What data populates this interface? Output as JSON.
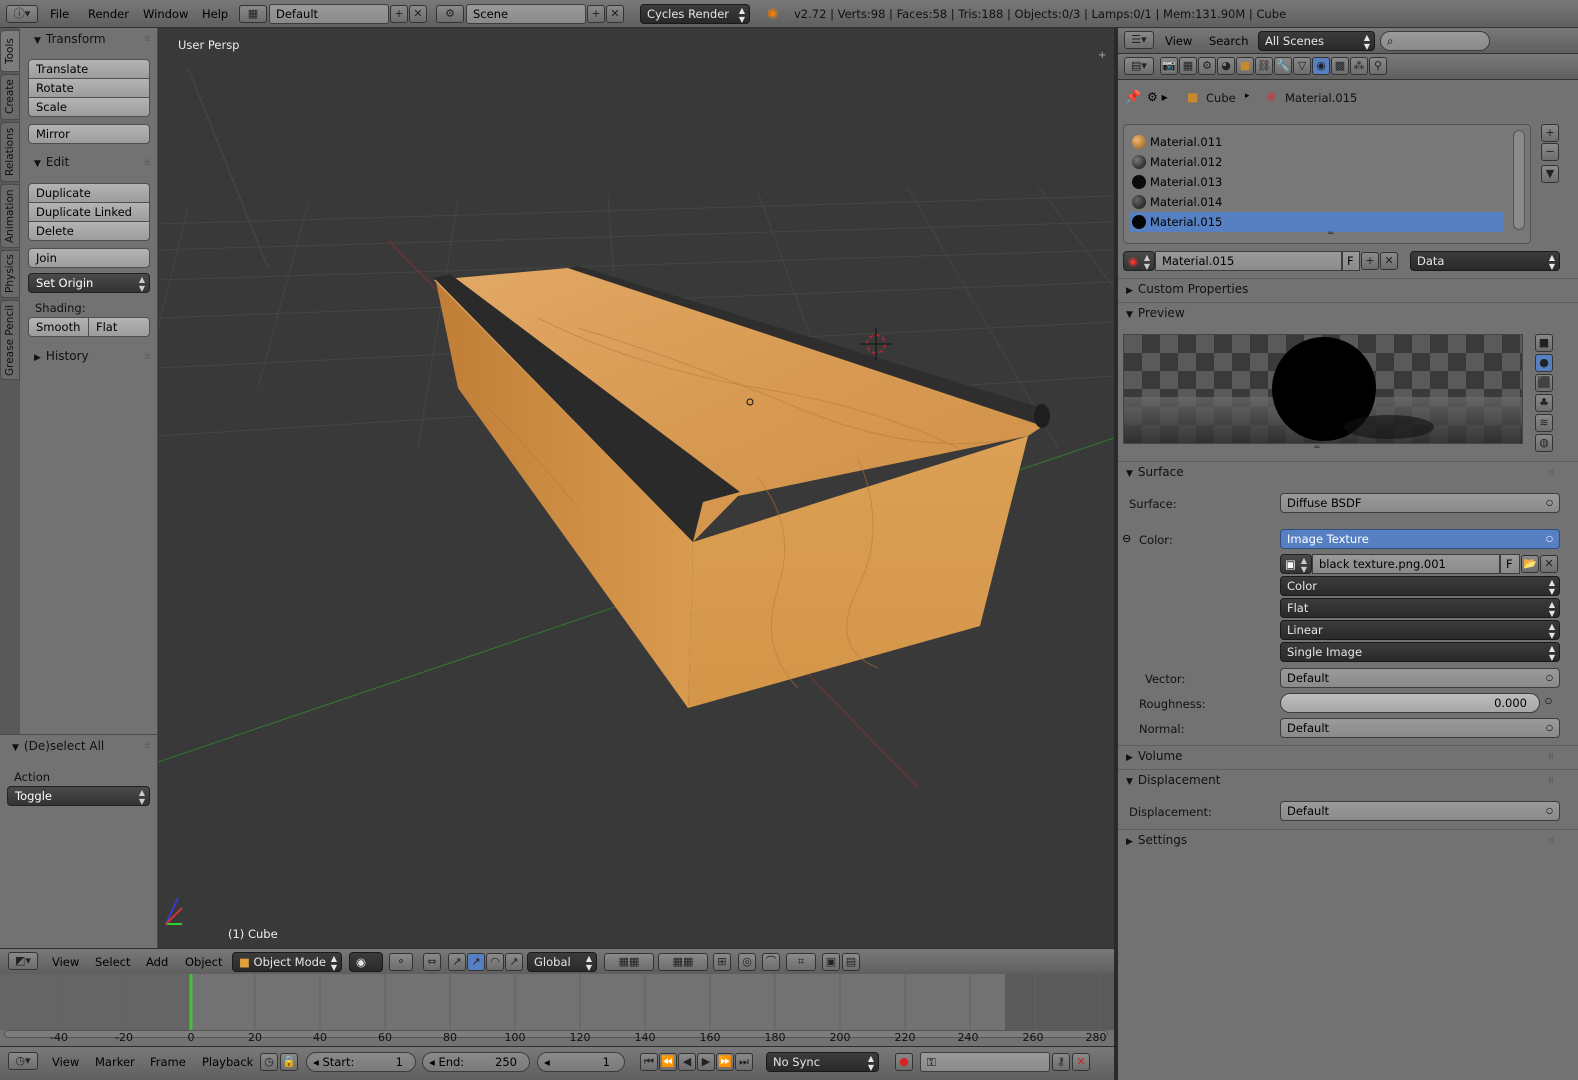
{
  "topbar": {
    "menus": [
      "File",
      "Render",
      "Window",
      "Help"
    ],
    "layout": "Default",
    "scene": "Scene",
    "engine": "Cycles Render",
    "stats": "v2.72 | Verts:98 | Faces:58 | Tris:188 | Objects:0/3 | Lamps:0/1 | Mem:131.90M | Cube"
  },
  "tool_tabs": [
    "Tools",
    "Create",
    "Relations",
    "Animation",
    "Physics",
    "Grease Pencil"
  ],
  "toolshelf": {
    "transform_title": "Transform",
    "translate": "Translate",
    "rotate": "Rotate",
    "scale": "Scale",
    "mirror": "Mirror",
    "edit_title": "Edit",
    "duplicate": "Duplicate",
    "duplicate_linked": "Duplicate Linked",
    "delete": "Delete",
    "join": "Join",
    "set_origin": "Set Origin",
    "shading_label": "Shading:",
    "smooth": "Smooth",
    "flat": "Flat",
    "history_title": "History"
  },
  "operator": {
    "title": "(De)select All",
    "action_label": "Action",
    "action_value": "Toggle"
  },
  "viewport": {
    "view_name": "User Persp",
    "object_label": "(1) Cube"
  },
  "view3d_header": {
    "menus": [
      "View",
      "Select",
      "Add",
      "Object"
    ],
    "mode": "Object Mode",
    "orientation": "Global"
  },
  "timeline": {
    "ticks": [
      "-40",
      "-20",
      "0",
      "20",
      "40",
      "60",
      "80",
      "100",
      "120",
      "140",
      "160",
      "180",
      "200",
      "220",
      "240",
      "260",
      "280"
    ],
    "current_frame_marker": 0,
    "menus": [
      "View",
      "Marker",
      "Frame",
      "Playback"
    ],
    "start_label": "Start:",
    "start_value": "1",
    "end_label": "End:",
    "end_value": "250",
    "current_value": "1",
    "sync": "No Sync"
  },
  "outliner_header": {
    "view": "View",
    "search": "Search",
    "scenes": "All Scenes"
  },
  "properties": {
    "breadcrumb_object": "Cube",
    "breadcrumb_material": "Material.015",
    "materials": [
      {
        "name": "Material.011",
        "color": "#c8892f"
      },
      {
        "name": "Material.012",
        "color": "#2a2a2a"
      },
      {
        "name": "Material.013",
        "color": "#111111"
      },
      {
        "name": "Material.014",
        "color": "#2a2a2a"
      },
      {
        "name": "Material.015",
        "color": "#0a0a0a"
      }
    ],
    "selected_material": "Material.015",
    "material_field": "Material.015",
    "fake_user": "F",
    "link": "Data",
    "custom_properties": "Custom Properties",
    "preview": "Preview",
    "surface_title": "Surface",
    "surface_label": "Surface:",
    "surface_value": "Diffuse BSDF",
    "color_label": "Color:",
    "color_value": "Image Texture",
    "image_name": "black texture.png.001",
    "image_f": "F",
    "color_space": "Color",
    "projection": "Flat",
    "interpolation": "Linear",
    "source": "Single Image",
    "vector_label": "Vector:",
    "vector_value": "Default",
    "roughness_label": "Roughness:",
    "roughness_value": "0.000",
    "normal_label": "Normal:",
    "normal_value": "Default",
    "volume_title": "Volume",
    "displacement_title": "Displacement",
    "displacement_label": "Displacement:",
    "displacement_value": "Default",
    "settings_title": "Settings"
  },
  "colors": {
    "selection": "#5680c2",
    "viewport_bg": "#393939",
    "panel_bg": "#727272",
    "wood": "#d69a4e",
    "frame_line": "#44c13b"
  }
}
